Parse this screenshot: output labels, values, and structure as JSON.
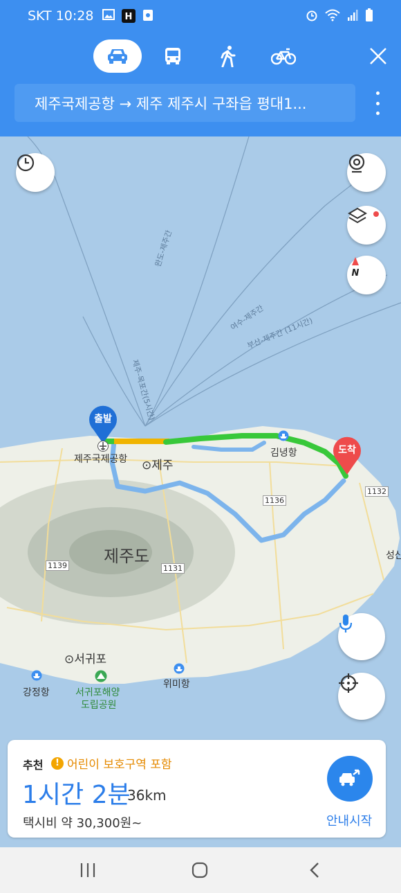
{
  "status_bar": {
    "carrier_time": "SKT 10:28"
  },
  "header": {
    "modes": [
      "car",
      "bus",
      "walk",
      "bicycle"
    ],
    "route_text": "제주국제공항 → 제주 제주시 구좌읍 평대1..."
  },
  "map": {
    "start_pin_label": "출발",
    "end_pin_label": "도착",
    "labels": {
      "airport": "제주국제공항",
      "jeju_city": "제주",
      "gimnyeong": "김녕항",
      "jejudo": "제주도",
      "seogwipo": "서귀포",
      "gangjeong": "강정항",
      "seogwipo_park_1": "서귀포해양",
      "seogwipo_park_2": "도립공원",
      "wimi": "위미항",
      "seongsan": "성산",
      "route_1132": "1132",
      "route_1136": "1136",
      "route_1139": "1139",
      "route_1131": "1131",
      "ferry_wando": "완도-제주간",
      "ferry_yeosu": "여수-제주간",
      "ferry_busan": "부산-제주간 (11시간)",
      "ferry_mokpo": "제주-목포간(5시간)"
    },
    "colors": {
      "sea": "#aacbe8",
      "land": "#eef0e8",
      "route_main": "#38c83a",
      "route_congested": "#f0b400",
      "route_alt": "#7cb4ec",
      "accent": "#3d8ff0",
      "start_pin": "#1f6fd6",
      "end_pin": "#ee4b4b"
    }
  },
  "summary": {
    "recommend": "추천",
    "warning": "어린이 보호구역 포함",
    "duration": "1시간 2분",
    "distance": "36km",
    "taxi": "택시비 약 30,300원~",
    "start_navigation": "안내시작"
  }
}
